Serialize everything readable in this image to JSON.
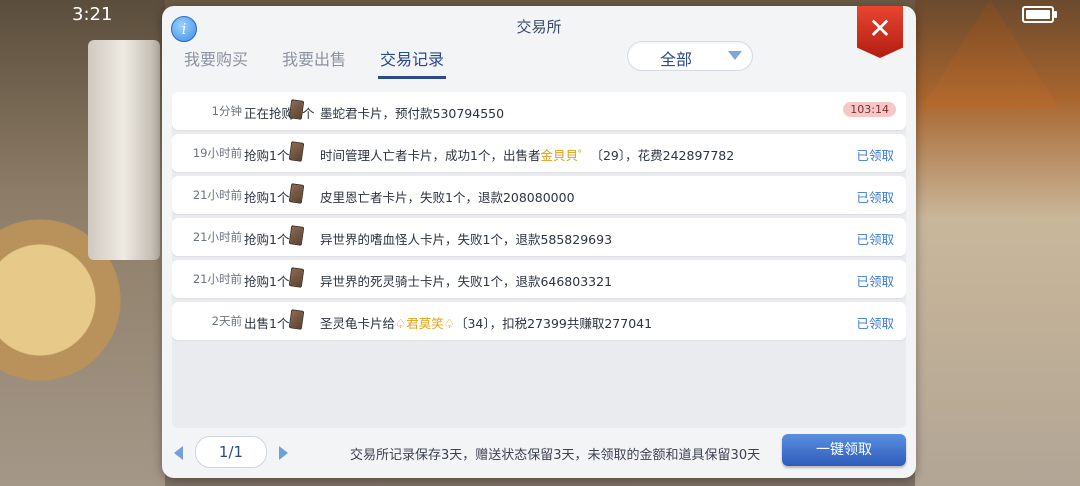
{
  "status_bar": {
    "time": "3:21"
  },
  "window": {
    "title": "交易所",
    "info_icon": "i",
    "close_icon": "✕"
  },
  "tabs": [
    {
      "label": "我要购买",
      "active": false
    },
    {
      "label": "我要出售",
      "active": false
    },
    {
      "label": "交易记录",
      "active": true
    }
  ],
  "filter": {
    "selected": "全部"
  },
  "records": [
    {
      "time": "1分钟",
      "action": "正在抢购1个",
      "desc_parts": [
        "墨蛇君卡片，预付款530794550"
      ],
      "status": "",
      "timer": "103:14"
    },
    {
      "time": "19小时前",
      "action": "抢购1个",
      "desc_pre": "时间管理人亡者卡片，成功1个，出售者",
      "seller": "金貝貝゜",
      "desc_post": "〔29〕，花费242897782",
      "status": "已领取"
    },
    {
      "time": "21小时前",
      "action": "抢购1个",
      "desc": "皮里恩亡者卡片，失败1个，退款208080000",
      "status": "已领取"
    },
    {
      "time": "21小时前",
      "action": "抢购1个",
      "desc": "异世界的嗜血怪人卡片，失败1个，退款585829693",
      "status": "已领取"
    },
    {
      "time": "21小时前",
      "action": "抢购1个",
      "desc": "异世界的死灵骑士卡片，失败1个，退款646803321",
      "status": "已领取"
    },
    {
      "time": "2天前",
      "action": "出售1个",
      "desc_pre": "圣灵龟卡片给",
      "buyer": "♤君莫笑♤",
      "desc_post": "〔34〕，扣税27399共赚取277041",
      "status": "已领取"
    }
  ],
  "pagination": {
    "page": "1/1"
  },
  "footer": {
    "note": "交易所记录保存3天，赠送状态保留3天，未领取的金额和道具保留30天",
    "claim_all_label": "一键领取"
  }
}
